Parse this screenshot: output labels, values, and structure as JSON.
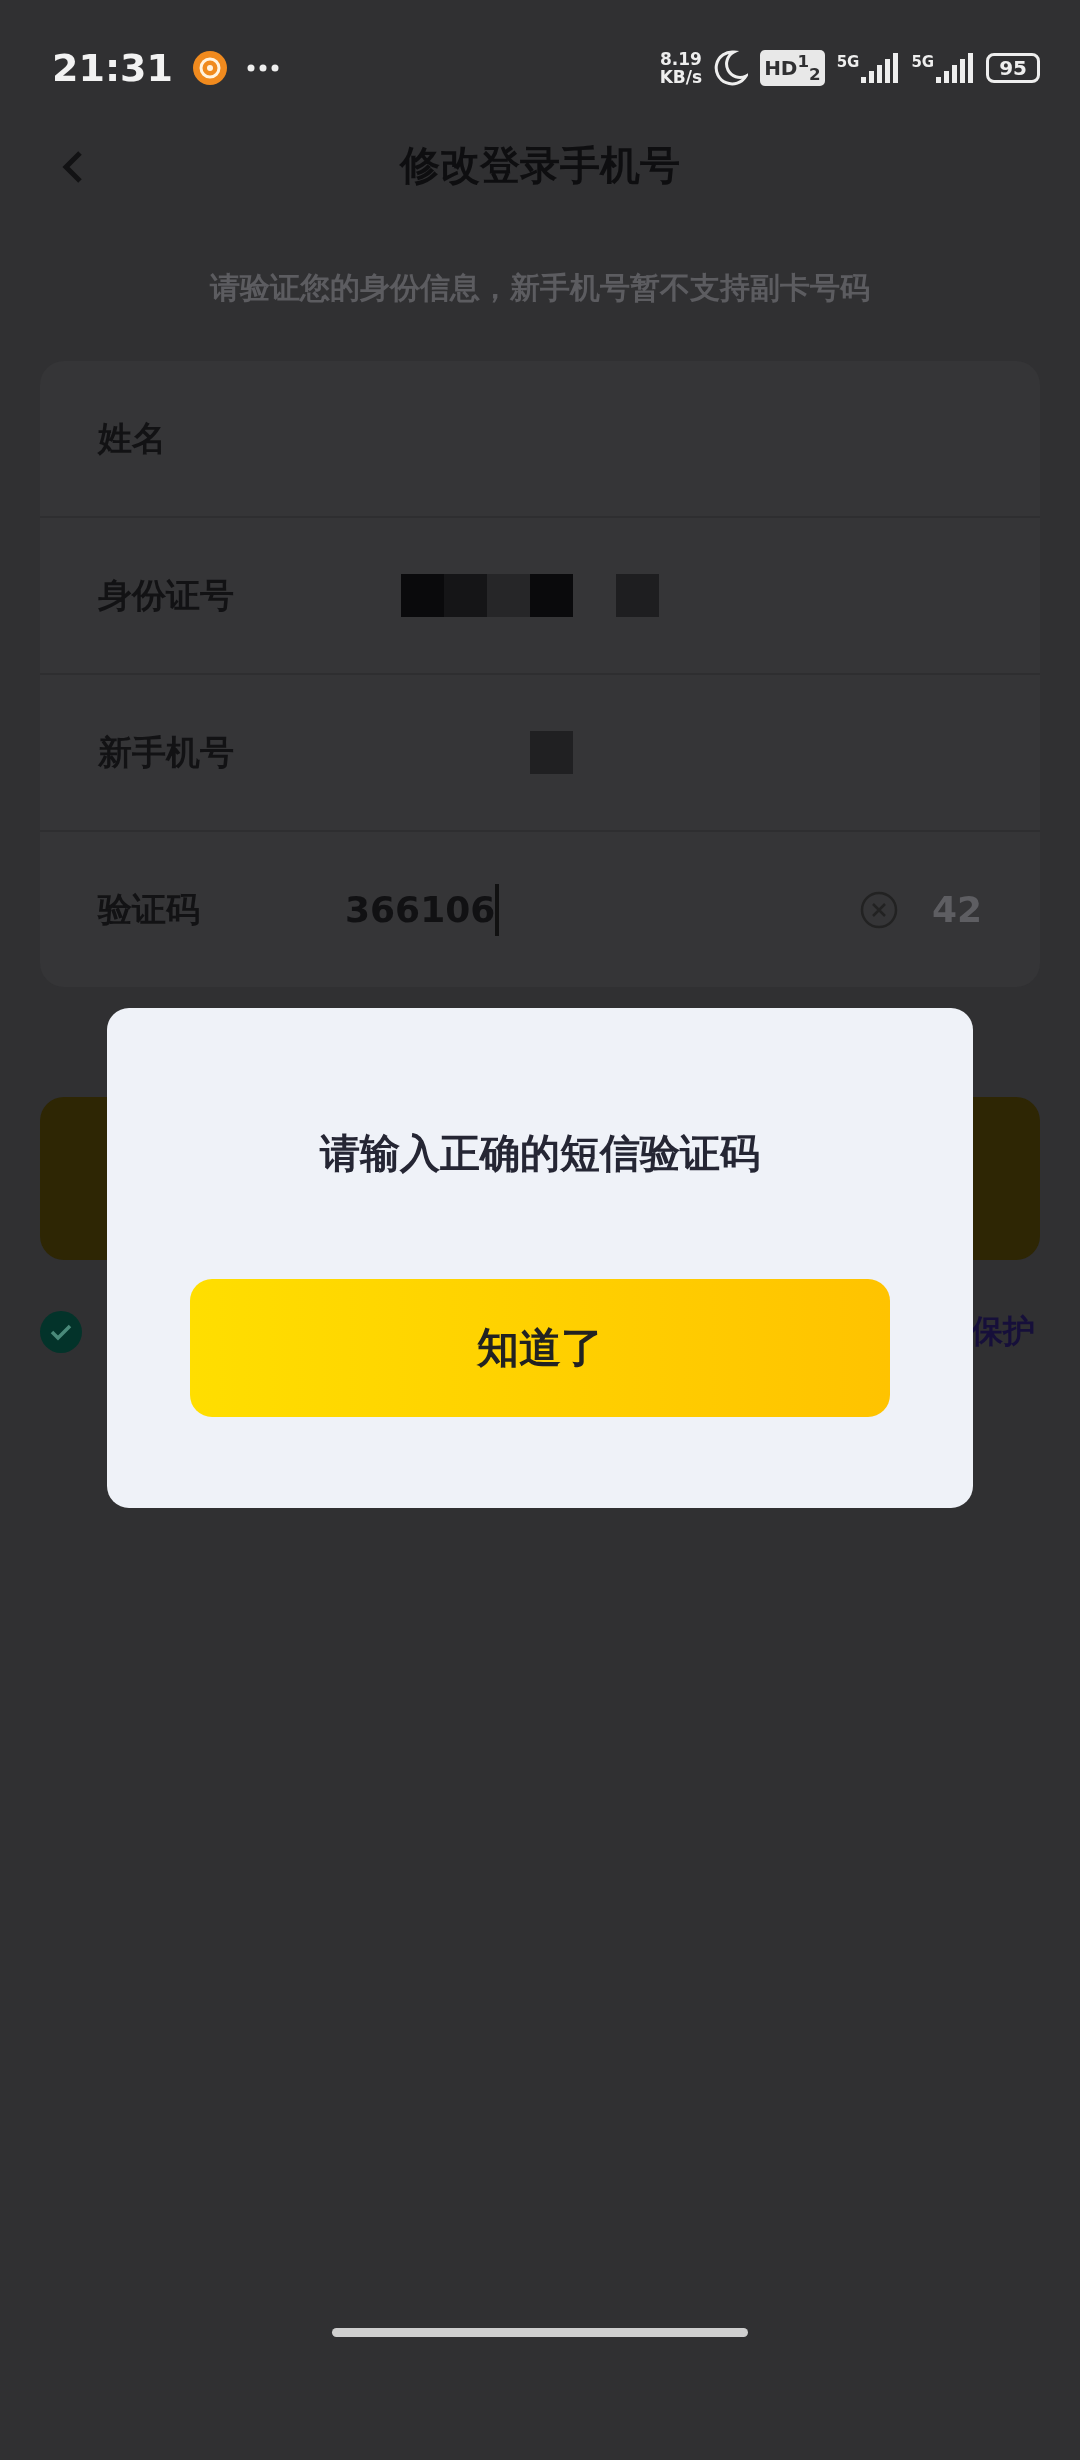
{
  "status_bar": {
    "time": "21:31",
    "speed_value": "8.19",
    "speed_unit": "KB/s",
    "hd_badge": "HD$^{1}$$_{2}$",
    "sim1": "5G",
    "sim2": "5G",
    "battery": "95"
  },
  "header": {
    "title": "修改登录手机号"
  },
  "subtitle": "请验证您的身份信息，新手机号暂不支持副卡号码",
  "form": {
    "rows": [
      {
        "kind": "text",
        "label": "姓名"
      },
      {
        "kind": "redacted",
        "label": "身份证号"
      },
      {
        "kind": "redacted",
        "label": "新手机号"
      },
      {
        "kind": "code",
        "label": "验证码",
        "value": "366106",
        "countdown": "42"
      }
    ]
  },
  "agreement": {
    "checked": true,
    "text": "保护"
  },
  "dialog": {
    "message": "请输入正确的短信验证码",
    "button": "知道了"
  }
}
